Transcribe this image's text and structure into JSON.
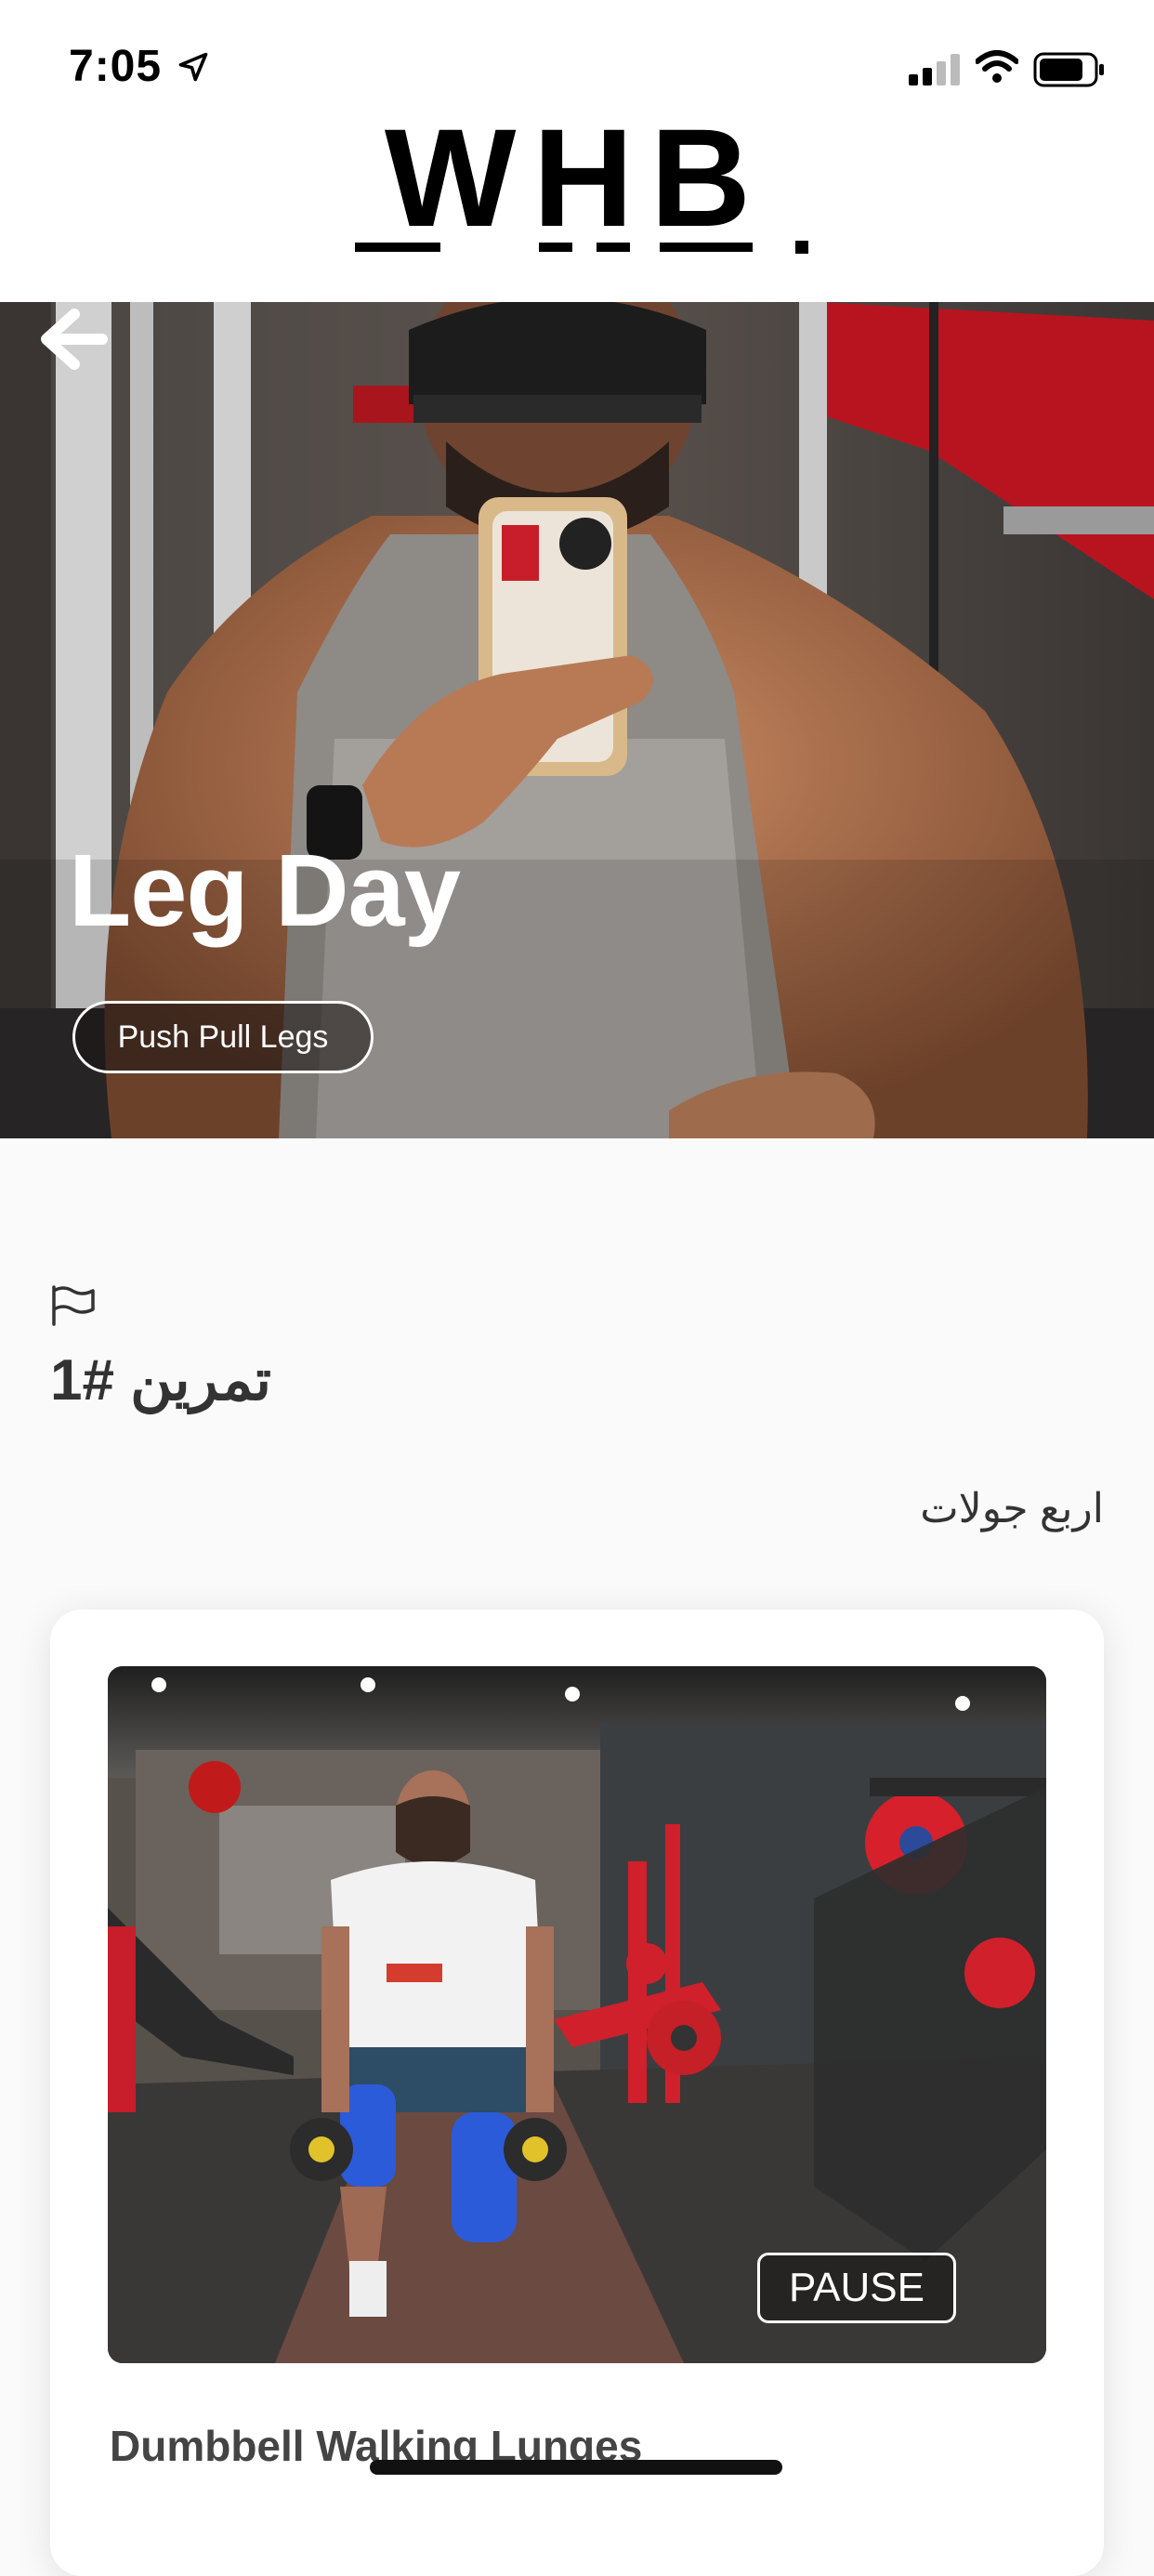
{
  "status_bar": {
    "time": "7:05",
    "location_icon": "location-arrow-icon",
    "signal_icon": "cellular-signal-icon",
    "wifi_icon": "wifi-icon",
    "battery_icon": "battery-icon"
  },
  "header": {
    "logo_text": "WHB."
  },
  "hero": {
    "back_icon": "arrow-left-icon",
    "title": "Leg Day",
    "program_chip": "Push Pull Legs"
  },
  "exercise": {
    "flag_icon": "flag-icon",
    "heading": "تمرين #1",
    "rounds": "اربع جولات",
    "card": {
      "pause_label": "PAUSE",
      "name": "Dumbbell Walking Lunges"
    }
  },
  "colors": {
    "background": "#fbfafa",
    "accent_red": "#d0202c",
    "text_dark": "#333333"
  }
}
